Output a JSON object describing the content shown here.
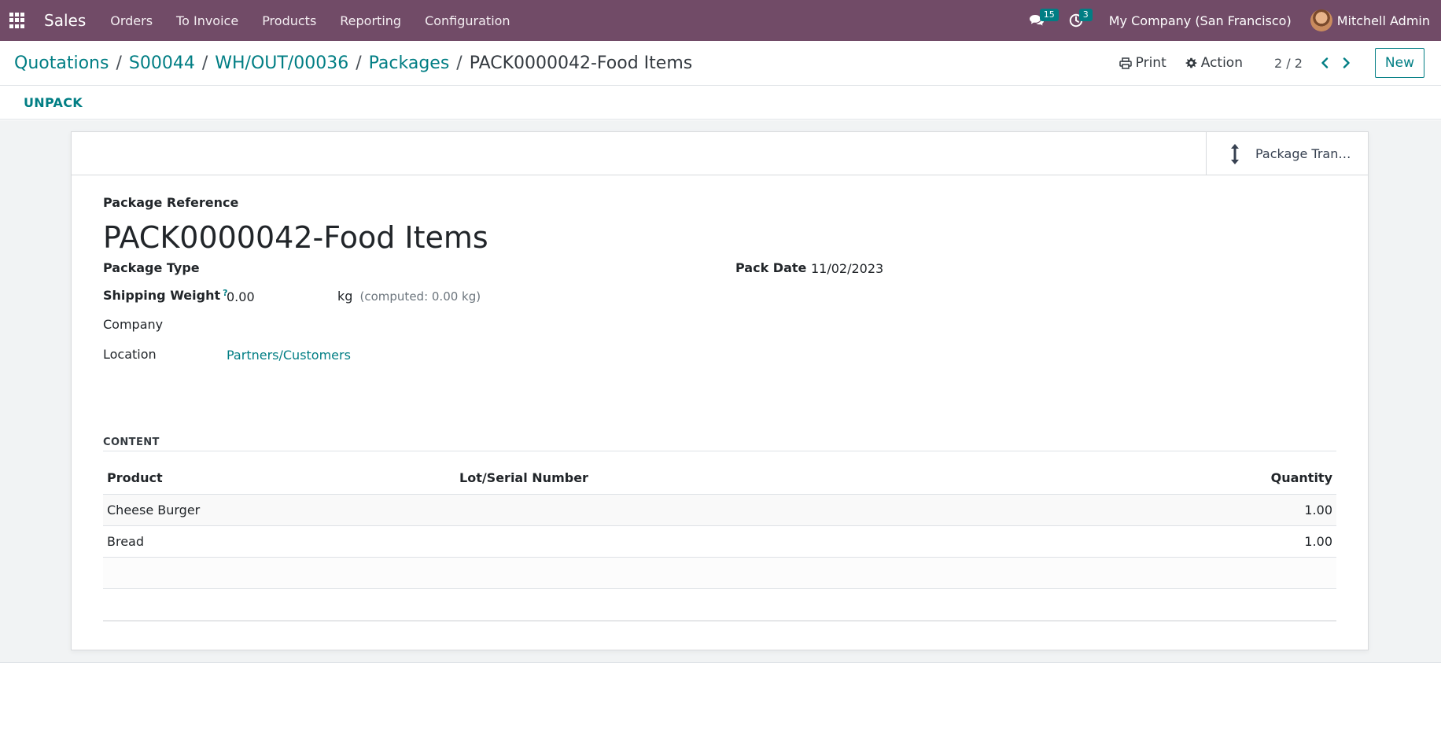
{
  "navbar": {
    "app_name": "Sales",
    "menu": [
      "Orders",
      "To Invoice",
      "Products",
      "Reporting",
      "Configuration"
    ],
    "messages_count": "15",
    "activities_count": "3",
    "company": "My Company (San Francisco)",
    "user": "Mitchell Admin"
  },
  "breadcrumb": {
    "items": [
      "Quotations",
      "S00044",
      "WH/OUT/00036",
      "Packages"
    ],
    "current": "PACK0000042-Food Items"
  },
  "control": {
    "print_label": "Print",
    "action_label": "Action",
    "pager": "2 / 2",
    "new_label": "New"
  },
  "status": {
    "unpack_label": "UNPACK"
  },
  "smart_button": {
    "label": "Package Tran…",
    "icon": "vertical-arrows-icon"
  },
  "form": {
    "reference_label": "Package Reference",
    "reference_value": "PACK0000042-Food Items",
    "package_type_label": "Package Type",
    "package_type_value": "",
    "pack_date_label": "Pack Date",
    "pack_date_value": "11/02/2023",
    "shipping_weight_label": "Shipping Weight",
    "shipping_weight_help": "?",
    "shipping_weight_value": "0.00",
    "weight_unit": "kg",
    "computed_weight": "(computed: 0.00 kg)",
    "company_label": "Company",
    "company_value": "",
    "location_label": "Location",
    "location_value": "Partners/Customers"
  },
  "content": {
    "section_title": "CONTENT",
    "headers": {
      "product": "Product",
      "lot": "Lot/Serial Number",
      "quantity": "Quantity"
    },
    "rows": [
      {
        "product": "Cheese Burger",
        "lot": "",
        "quantity": "1.00"
      },
      {
        "product": "Bread",
        "lot": "",
        "quantity": "1.00"
      }
    ]
  },
  "colors": {
    "navbar": "#714b67",
    "accent": "#017e84",
    "background": "#f1f3f4"
  }
}
